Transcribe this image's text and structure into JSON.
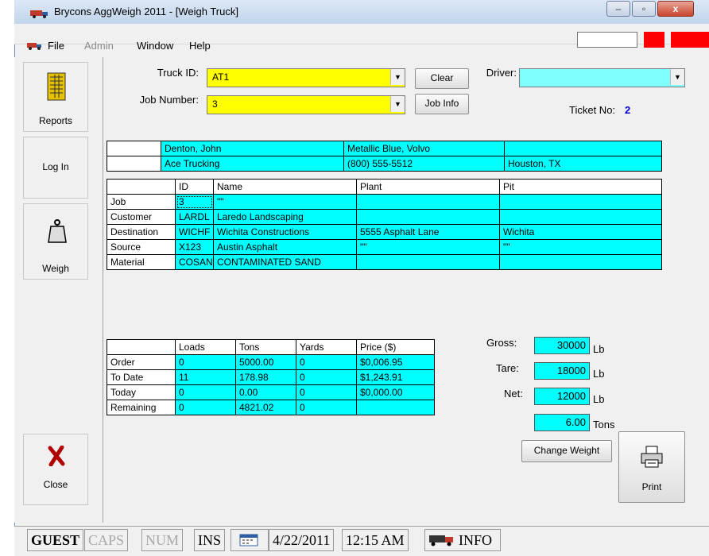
{
  "window": {
    "title": "Brycons AggWeigh 2011 - [Weigh Truck]",
    "minimize": "–",
    "maximize": "▫",
    "close": "x"
  },
  "menu": {
    "file": "File",
    "admin": "Admin",
    "window": "Window",
    "help": "Help"
  },
  "toolbar": {
    "reports": "Reports",
    "login": "Log In",
    "weigh": "Weigh",
    "close": "Close"
  },
  "form": {
    "truck_id_label": "Truck ID:",
    "truck_id_value": "AT1",
    "job_number_label": "Job Number:",
    "job_number_value": "3",
    "clear_button": "Clear",
    "job_info_button": "Job Info",
    "driver_label": "Driver:",
    "driver_value": "",
    "ticket_label": "Ticket No:",
    "ticket_value": "2"
  },
  "truck_info": {
    "row1": [
      "Denton, John",
      "Metallic Blue, Volvo",
      ""
    ],
    "row2": [
      "Ace Trucking",
      "(800) 555-5512",
      "Houston, TX"
    ]
  },
  "details": {
    "headers": [
      "",
      "ID",
      "Name",
      "Plant",
      "Pit"
    ],
    "rows": [
      [
        "Job",
        "3",
        "\"\"",
        "",
        ""
      ],
      [
        "Customer",
        "LARDL",
        "Laredo Landscaping",
        "",
        ""
      ],
      [
        "Destination",
        "WICHF",
        "Wichita Constructions",
        "5555 Asphalt Lane",
        "Wichita"
      ],
      [
        "Source",
        "X123",
        "Austin Asphalt",
        "\"\"",
        "\"\""
      ],
      [
        "Material",
        "COSAN",
        "CONTAMINATED SAND",
        "",
        ""
      ]
    ]
  },
  "totals": {
    "headers": [
      "",
      "Loads",
      "Tons",
      "Yards",
      "Price ($)"
    ],
    "rows": [
      [
        "Order",
        "0",
        "5000.00",
        "0",
        "$0,006.95"
      ],
      [
        "To Date",
        "11",
        "178.98",
        "0",
        "$1,243.91"
      ],
      [
        "Today",
        "0",
        "0.00",
        "0",
        "$0,000.00"
      ],
      [
        "Remaining",
        "0",
        "4821.02",
        "0",
        ""
      ]
    ]
  },
  "weights": {
    "gross_label": "Gross:",
    "gross_value": "30000",
    "gross_unit": "Lb",
    "tare_label": "Tare:",
    "tare_value": "18000",
    "tare_unit": "Lb",
    "net_label": "Net:",
    "net_value": "12000",
    "net_unit": "Lb",
    "tons_value": "6.00",
    "tons_unit": "Tons",
    "change_button": "Change Weight",
    "print_button": "Print"
  },
  "status": {
    "user": "GUEST",
    "caps": "CAPS",
    "num": "NUM",
    "ins": "INS",
    "date": "4/22/2011",
    "time": "12:15 AM",
    "info": "INFO"
  },
  "colors": {
    "field_yellow": "#ffff00",
    "grid_cyan": "#00ffff",
    "ticket_blue": "#0000cc"
  }
}
